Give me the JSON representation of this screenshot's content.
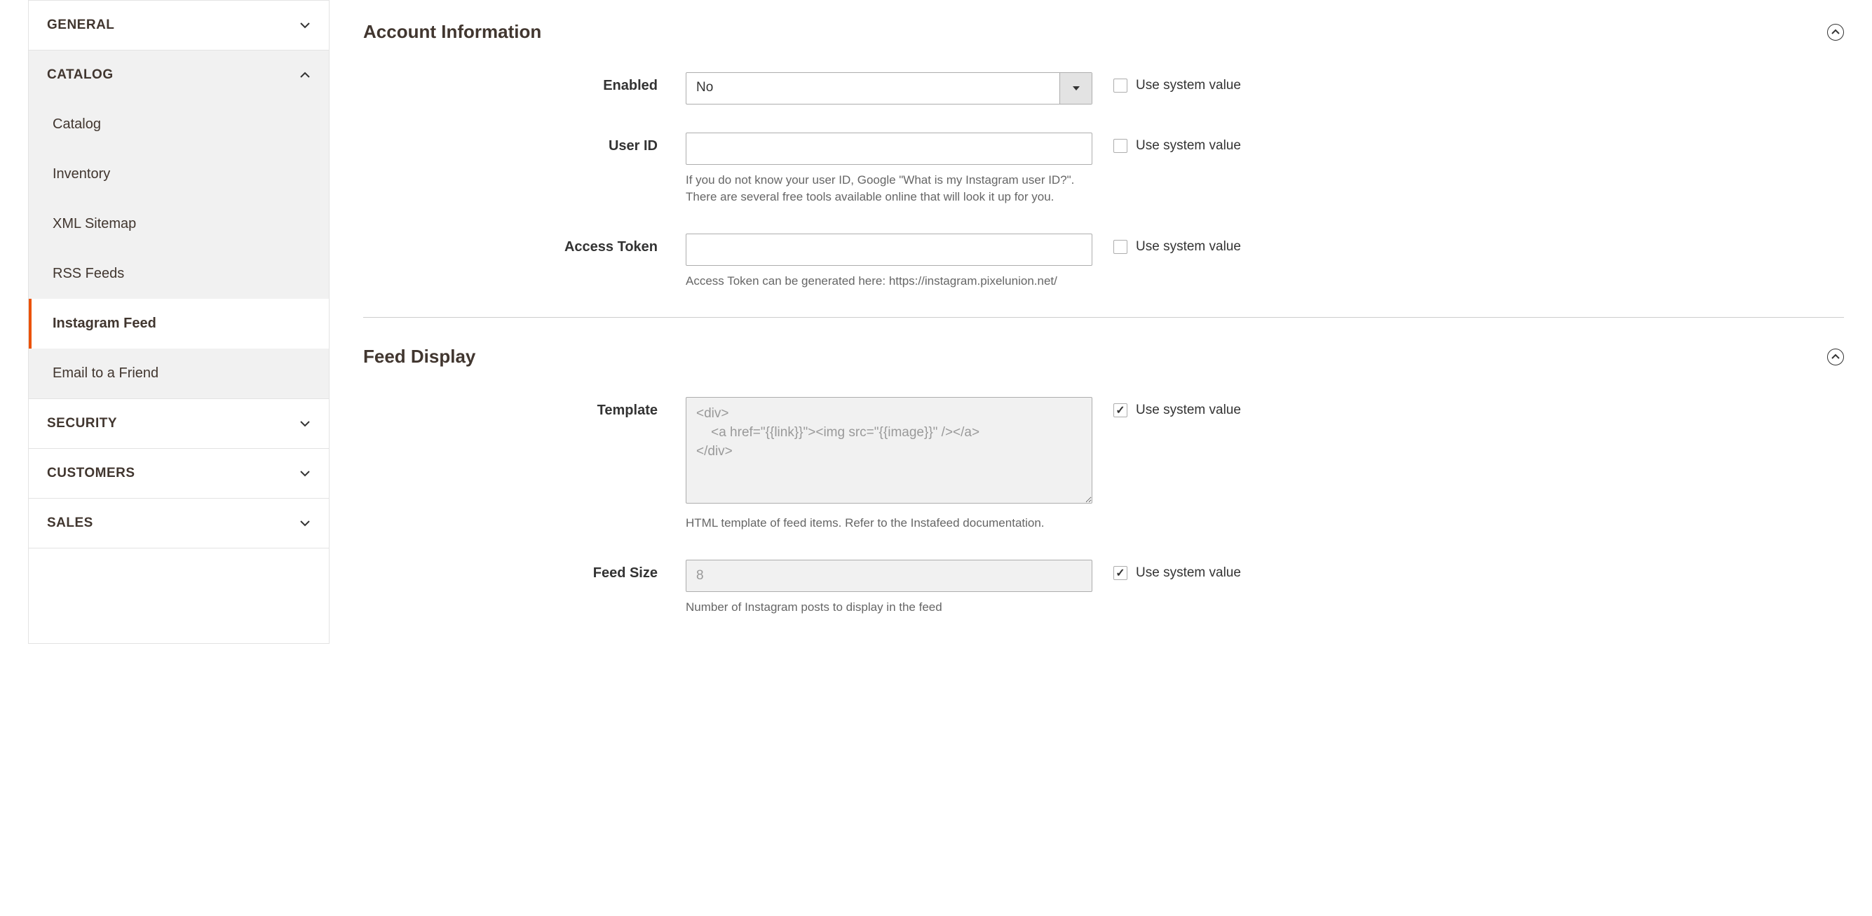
{
  "sidebar": {
    "sections": [
      {
        "label": "GENERAL",
        "expanded": false
      },
      {
        "label": "CATALOG",
        "expanded": true,
        "items": [
          {
            "label": "Catalog"
          },
          {
            "label": "Inventory"
          },
          {
            "label": "XML Sitemap"
          },
          {
            "label": "RSS Feeds"
          },
          {
            "label": "Instagram Feed",
            "active": true
          },
          {
            "label": "Email to a Friend"
          }
        ]
      },
      {
        "label": "SECURITY",
        "expanded": false
      },
      {
        "label": "CUSTOMERS",
        "expanded": false
      },
      {
        "label": "SALES",
        "expanded": false
      }
    ]
  },
  "sections": {
    "account": {
      "title": "Account Information",
      "enabled": {
        "label": "Enabled",
        "value": "No",
        "sys_label": "Use system value",
        "sys_checked": false
      },
      "userid": {
        "label": "User ID",
        "value": "",
        "hint": "If you do not know your user ID, Google \"What is my Instagram user ID?\". There are several free tools available online that will look it up for you.",
        "sys_label": "Use system value",
        "sys_checked": false
      },
      "token": {
        "label": "Access Token",
        "value": "",
        "hint": "Access Token can be generated here: https://instagram.pixelunion.net/",
        "sys_label": "Use system value",
        "sys_checked": false
      }
    },
    "feed": {
      "title": "Feed Display",
      "template": {
        "label": "Template",
        "value": "<div>\n    <a href=\"{{link}}\"><img src=\"{{image}}\" /></a>\n</div>",
        "hint": "HTML template of feed items. Refer to the Instafeed documentation.",
        "sys_label": "Use system value",
        "sys_checked": true
      },
      "feedsize": {
        "label": "Feed Size",
        "value": "8",
        "hint": "Number of Instagram posts to display in the feed",
        "sys_label": "Use system value",
        "sys_checked": true
      }
    }
  }
}
